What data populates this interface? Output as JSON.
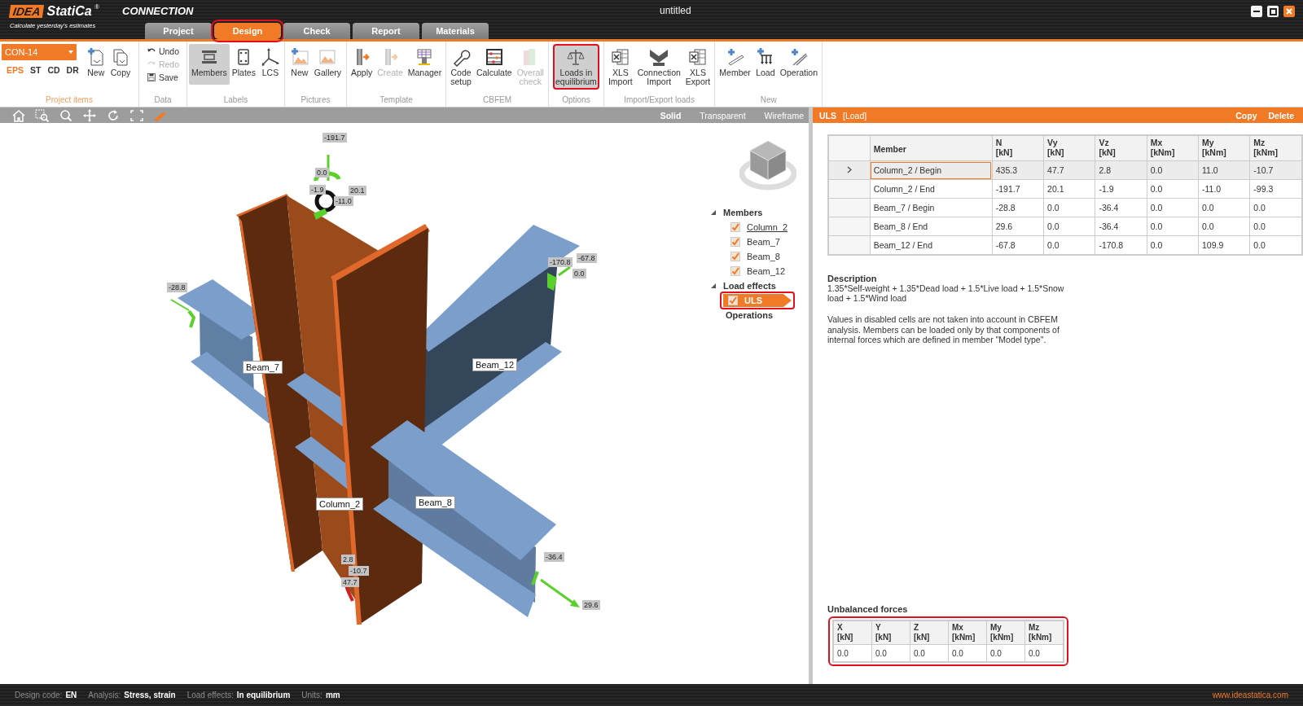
{
  "app": {
    "logo": "IDEA",
    "brand": "StatiCa",
    "reg": "®",
    "product": "CONNECTION",
    "tagline": "Calculate yesterday's estimates"
  },
  "window": {
    "title": "untitled"
  },
  "tabs": [
    {
      "label": "Project",
      "selected": false,
      "highlighted": false
    },
    {
      "label": "Design",
      "selected": true,
      "highlighted": true
    },
    {
      "label": "Check",
      "selected": false,
      "highlighted": false
    },
    {
      "label": "Report",
      "selected": false,
      "highlighted": false
    },
    {
      "label": "Materials",
      "selected": false,
      "highlighted": false
    }
  ],
  "ribbon": {
    "connection": "CON-14",
    "standards": [
      {
        "label": "EPS",
        "selected": true
      },
      {
        "label": "ST",
        "selected": false
      },
      {
        "label": "CD",
        "selected": false
      },
      {
        "label": "DR",
        "selected": false
      }
    ],
    "groups": [
      {
        "title": "Project items",
        "active": true,
        "buttons": [
          {
            "label": "New",
            "kind": "large",
            "disabled": false,
            "selected": false,
            "highlighted": false
          },
          {
            "label": "Copy",
            "kind": "large",
            "disabled": false,
            "selected": false,
            "highlighted": false
          }
        ]
      },
      {
        "title": "Data",
        "active": false,
        "buttons": [
          {
            "label": "Undo",
            "kind": "small",
            "disabled": false
          },
          {
            "label": "Redo",
            "kind": "small",
            "disabled": true
          },
          {
            "label": "Save",
            "kind": "small",
            "disabled": false
          }
        ]
      },
      {
        "title": "Labels",
        "active": false,
        "buttons": [
          {
            "label": "Members",
            "kind": "large",
            "disabled": false,
            "selected": true,
            "highlighted": false
          },
          {
            "label": "Plates",
            "kind": "large",
            "disabled": false,
            "selected": false,
            "highlighted": false
          },
          {
            "label": "LCS",
            "kind": "large",
            "disabled": false,
            "selected": false,
            "highlighted": false
          }
        ]
      },
      {
        "title": "Pictures",
        "active": false,
        "buttons": [
          {
            "label": "New",
            "kind": "large",
            "disabled": false,
            "selected": false,
            "highlighted": false
          },
          {
            "label": "Gallery",
            "kind": "large",
            "disabled": false,
            "selected": false,
            "highlighted": false
          }
        ]
      },
      {
        "title": "Template",
        "active": false,
        "buttons": [
          {
            "label": "Apply",
            "kind": "large",
            "disabled": false,
            "selected": false,
            "highlighted": false
          },
          {
            "label": "Create",
            "kind": "large",
            "disabled": true,
            "selected": false,
            "highlighted": false
          },
          {
            "label": "Manager",
            "kind": "large",
            "disabled": false,
            "selected": false,
            "highlighted": false
          }
        ]
      },
      {
        "title": "CBFEM",
        "active": false,
        "buttons": [
          {
            "label": "Code\nsetup",
            "kind": "large",
            "disabled": false,
            "selected": false,
            "highlighted": false
          },
          {
            "label": "Calculate",
            "kind": "large",
            "disabled": false,
            "selected": false,
            "highlighted": false
          },
          {
            "label": "Overall\ncheck",
            "kind": "large",
            "disabled": true,
            "selected": false,
            "highlighted": false
          }
        ]
      },
      {
        "title": "Options",
        "active": false,
        "buttons": [
          {
            "label": "Loads in\nequilibrium",
            "kind": "large",
            "disabled": false,
            "selected": true,
            "highlighted": true
          }
        ]
      },
      {
        "title": "Import/Export loads",
        "active": false,
        "buttons": [
          {
            "label": "XLS\nImport",
            "kind": "large",
            "disabled": false,
            "selected": false,
            "highlighted": false
          },
          {
            "label": "Connection\nImport",
            "kind": "large",
            "disabled": false,
            "selected": false,
            "highlighted": false
          },
          {
            "label": "XLS\nExport",
            "kind": "large",
            "disabled": false,
            "selected": false,
            "highlighted": false
          }
        ]
      },
      {
        "title": "New",
        "active": false,
        "buttons": [
          {
            "label": "Member",
            "kind": "large",
            "disabled": false,
            "selected": false,
            "highlighted": false
          },
          {
            "label": "Load",
            "kind": "large",
            "disabled": false,
            "selected": false,
            "highlighted": false
          },
          {
            "label": "Operation",
            "kind": "large",
            "disabled": false,
            "selected": false,
            "highlighted": false
          }
        ]
      }
    ]
  },
  "view_modes": [
    {
      "label": "Solid",
      "selected": true
    },
    {
      "label": "Transparent",
      "selected": false
    },
    {
      "label": "Wireframe",
      "selected": false
    }
  ],
  "model_labels": [
    {
      "text": "-191.7",
      "kind": "force"
    },
    {
      "text": "0.0",
      "kind": "force"
    },
    {
      "text": "-1.9",
      "kind": "force"
    },
    {
      "text": "20.1",
      "kind": "force"
    },
    {
      "text": "-11.0",
      "kind": "force"
    },
    {
      "text": "-170.8",
      "kind": "force"
    },
    {
      "text": "-67.8",
      "kind": "force"
    },
    {
      "text": "0.0",
      "kind": "force"
    },
    {
      "text": "-28.8",
      "kind": "force"
    },
    {
      "text": "Beam_7",
      "kind": "member"
    },
    {
      "text": "Beam_12",
      "kind": "member"
    },
    {
      "text": "Column_2",
      "kind": "member"
    },
    {
      "text": "Beam_8",
      "kind": "member"
    },
    {
      "text": "2.8",
      "kind": "force"
    },
    {
      "text": "-10.7",
      "kind": "force"
    },
    {
      "text": "47.7",
      "kind": "force"
    },
    {
      "text": "-36.4",
      "kind": "force"
    },
    {
      "text": "29.6",
      "kind": "force"
    }
  ],
  "tree": [
    {
      "label": "Members",
      "expanded": true,
      "children": [
        {
          "label": "Column_2",
          "kind": "member",
          "checked": true,
          "selected": true
        },
        {
          "label": "Beam_7",
          "kind": "member",
          "checked": true,
          "selected": false
        },
        {
          "label": "Beam_8",
          "kind": "member",
          "checked": true,
          "selected": false
        },
        {
          "label": "Beam_12",
          "kind": "member",
          "checked": true,
          "selected": false
        }
      ]
    },
    {
      "label": "Load effects",
      "expanded": true,
      "children": [
        {
          "label": "ULS",
          "kind": "load",
          "checked": true,
          "selected": true,
          "highlighted": true
        }
      ]
    },
    {
      "label": "Operations"
    }
  ],
  "panel": {
    "title": "ULS",
    "subtitle": "[Load]",
    "actions": [
      "Copy",
      "Delete"
    ]
  },
  "table": {
    "columns": [
      {
        "name": "Member"
      },
      {
        "name": "N",
        "unit": "[kN]"
      },
      {
        "name": "Vy",
        "unit": "[kN]"
      },
      {
        "name": "Vz",
        "unit": "[kN]"
      },
      {
        "name": "Mx",
        "unit": "[kNm]"
      },
      {
        "name": "My",
        "unit": "[kNm]"
      },
      {
        "name": "Mz",
        "unit": "[kNm]"
      }
    ],
    "rows": [
      {
        "selected": true,
        "cells": [
          "Column_2 / Begin",
          "435.3",
          "47.7",
          "2.8",
          "0.0",
          "11.0",
          "-10.7"
        ]
      },
      {
        "selected": false,
        "cells": [
          "Column_2 / End",
          "-191.7",
          "20.1",
          "-1.9",
          "0.0",
          "-11.0",
          "-99.3"
        ]
      },
      {
        "selected": false,
        "cells": [
          "Beam_7 / Begin",
          "-28.8",
          "0.0",
          "-36.4",
          "0.0",
          "0.0",
          "0.0"
        ]
      },
      {
        "selected": false,
        "cells": [
          "Beam_8 / End",
          "29.6",
          "0.0",
          "-36.4",
          "0.0",
          "0.0",
          "0.0"
        ]
      },
      {
        "selected": false,
        "cells": [
          "Beam_12 / End",
          "-67.8",
          "0.0",
          "-170.8",
          "0.0",
          "109.9",
          "0.0"
        ]
      }
    ]
  },
  "description": {
    "title": "Description",
    "text": "1.35*Self-weight + 1.35*Dead load + 1.5*Live load + 1.5*Snow load + 1.5*Wind load"
  },
  "note": "Values in disabled cells are not taken into account in CBFEM analysis. Members can be loaded only by that components of internal forces which are defined in member \"Model type\".",
  "unbalanced": {
    "title": "Unbalanced forces",
    "highlighted": true,
    "columns": [
      {
        "name": "X",
        "unit": "[kN]"
      },
      {
        "name": "Y",
        "unit": "[kN]"
      },
      {
        "name": "Z",
        "unit": "[kN]"
      },
      {
        "name": "Mx",
        "unit": "[kNm]"
      },
      {
        "name": "My",
        "unit": "[kNm]"
      },
      {
        "name": "Mz",
        "unit": "[kNm]"
      }
    ],
    "values": [
      "0.0",
      "0.0",
      "0.0",
      "0.0",
      "0.0",
      "0.0"
    ]
  },
  "status_bar": {
    "items": [
      {
        "label": "Design code:",
        "value": "EN"
      },
      {
        "label": "Analysis:",
        "value": "Stress, strain"
      },
      {
        "label": "Load effects:",
        "value": "In equilibrium"
      },
      {
        "label": "Units:",
        "value": "mm"
      }
    ],
    "website": "www.ideastatica.com"
  }
}
